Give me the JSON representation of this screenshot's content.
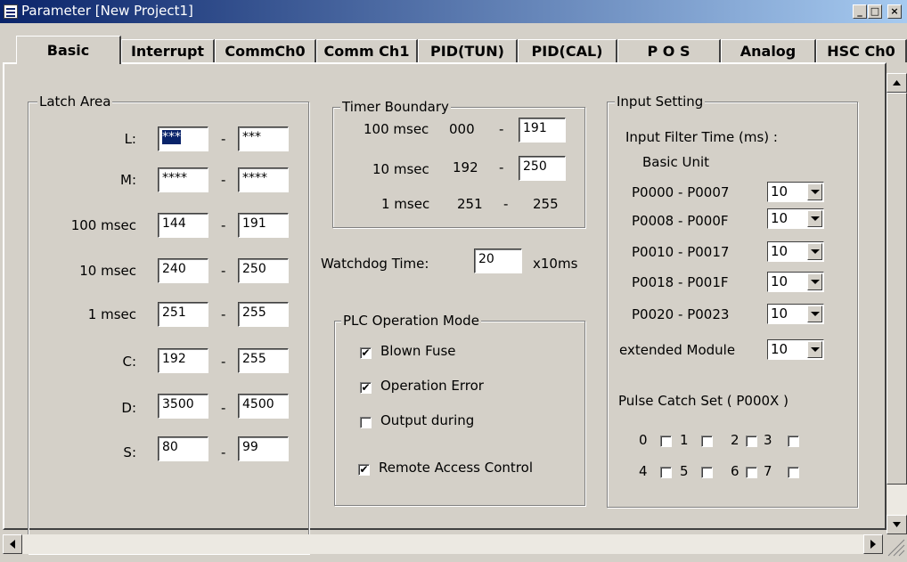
{
  "window": {
    "title": "Parameter [New Project1]",
    "min": "_",
    "max": "□",
    "close": "×"
  },
  "tabs": [
    "Basic",
    "Interrupt",
    "CommCh0",
    "Comm Ch1",
    "PID(TUN)",
    "PID(CAL)",
    "P O S",
    "Analog",
    "HSC Ch0"
  ],
  "latch": {
    "title": "Latch Area",
    "rows": [
      {
        "label": "L:",
        "from": "***",
        "to": "***"
      },
      {
        "label": "M:",
        "from": "****",
        "to": "****"
      },
      {
        "label": "100 msec",
        "from": "144",
        "to": "191"
      },
      {
        "label": "10 msec",
        "from": "240",
        "to": "250"
      },
      {
        "label": "1 msec",
        "from": "251",
        "to": "255"
      },
      {
        "label": "C:",
        "from": "192",
        "to": "255"
      },
      {
        "label": "D:",
        "from": "3500",
        "to": "4500"
      },
      {
        "label": "S:",
        "from": "80",
        "to": "99"
      }
    ],
    "dash": "-"
  },
  "timer": {
    "title": "Timer Boundary",
    "r1": {
      "label": "100 msec",
      "from": "000",
      "to": "191"
    },
    "r2": {
      "label": "10 msec",
      "from": "192",
      "to": "250"
    },
    "r3": {
      "label": "1 msec",
      "from": "251",
      "to": "255"
    }
  },
  "watchdog": {
    "label": "Watchdog Time:",
    "value": "20",
    "unit": "x10ms"
  },
  "plc": {
    "title": "PLC Operation Mode",
    "blown": {
      "label": "Blown Fuse",
      "checked": true
    },
    "operr": {
      "label": "Operation Error",
      "checked": true
    },
    "output": {
      "label": "Output during",
      "checked": false
    }
  },
  "remote": {
    "label": "Remote Access Control",
    "checked": true
  },
  "input": {
    "title": "Input Setting",
    "filter_label": "Input Filter Time (ms) :",
    "basic_unit": "Basic Unit",
    "rows": [
      {
        "from": "P0000",
        "to": "P0007",
        "value": "10"
      },
      {
        "from": "P0008",
        "to": "P000F",
        "value": "10"
      },
      {
        "from": "P0010",
        "to": "P0017",
        "value": "10"
      },
      {
        "from": "P0018",
        "to": "P001F",
        "value": "10"
      },
      {
        "from": "P0020",
        "to": "P0023",
        "value": "10"
      }
    ],
    "extended_label": "extended Module",
    "extended_value": "10",
    "pulse_label": "Pulse Catch Set ( P000X )",
    "pulse_bits": [
      "0",
      "1",
      "2",
      "3",
      "4",
      "5",
      "6",
      "7"
    ]
  },
  "check_glyph": "✔"
}
